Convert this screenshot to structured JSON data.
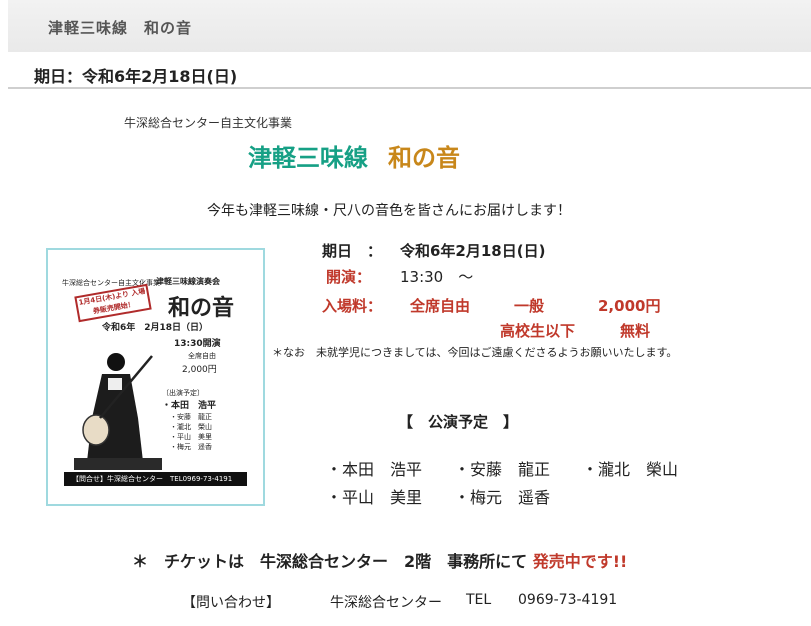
{
  "header": {
    "title": "津軽三味線　和の音"
  },
  "datebar": {
    "text": "期日：令和6年2月18日(日)"
  },
  "event": {
    "organizer": "牛深総合センター自主文化事業",
    "title_a": "津軽三味線",
    "title_b": "和の音",
    "tagline": "今年も津軽三味線・尺八の音色を皆さんにお届けします！",
    "date_label": "期日　：",
    "date_value": "令和6年2月18日(日)",
    "start_label": "開演：",
    "start_value": "13:30　～",
    "admission_label": "入場料：",
    "admission_seat": "全席自由",
    "general_label": "一般",
    "general_price": "2,000円",
    "student_label": "高校生以下",
    "student_price": "無料",
    "note": "＊なお　未就学児につきましては、今回はご遠慮くださるようお願いいたします。"
  },
  "poster": {
    "top_small": "牛深総合センター自主文化事業",
    "series": "津軽三味線演奏会",
    "sale_note": "1月4日(木)より 入場券販売開始！",
    "big_title": "和の音",
    "date": "令和6年　2月18日（日）",
    "time": "13:30開演",
    "seat": "全席自由",
    "price": "2,000円",
    "cast_label": "〔出演予定〕",
    "cast": [
      "・本田　浩平",
      "・安藤　龍正",
      "・瀧北　榮山",
      "・平山　美里",
      "・梅元　遥香"
    ],
    "footer": "【問合せ】牛深総合センター　TEL0969-73-4191"
  },
  "program": {
    "title": "【　公演予定　】",
    "row1": "・本田　浩平　　・安藤　龍正　　・瀧北　榮山",
    "row2": "・平山　美里　　・梅元　遥香"
  },
  "ticket": {
    "text": "＊　チケットは　牛深総合センター　2階　事務所にて",
    "highlight": "発売中です!!"
  },
  "contact": {
    "label": "【問い合わせ】",
    "venue": "牛深総合センター",
    "tel_label": "TEL",
    "tel": "0969-73-4191"
  }
}
